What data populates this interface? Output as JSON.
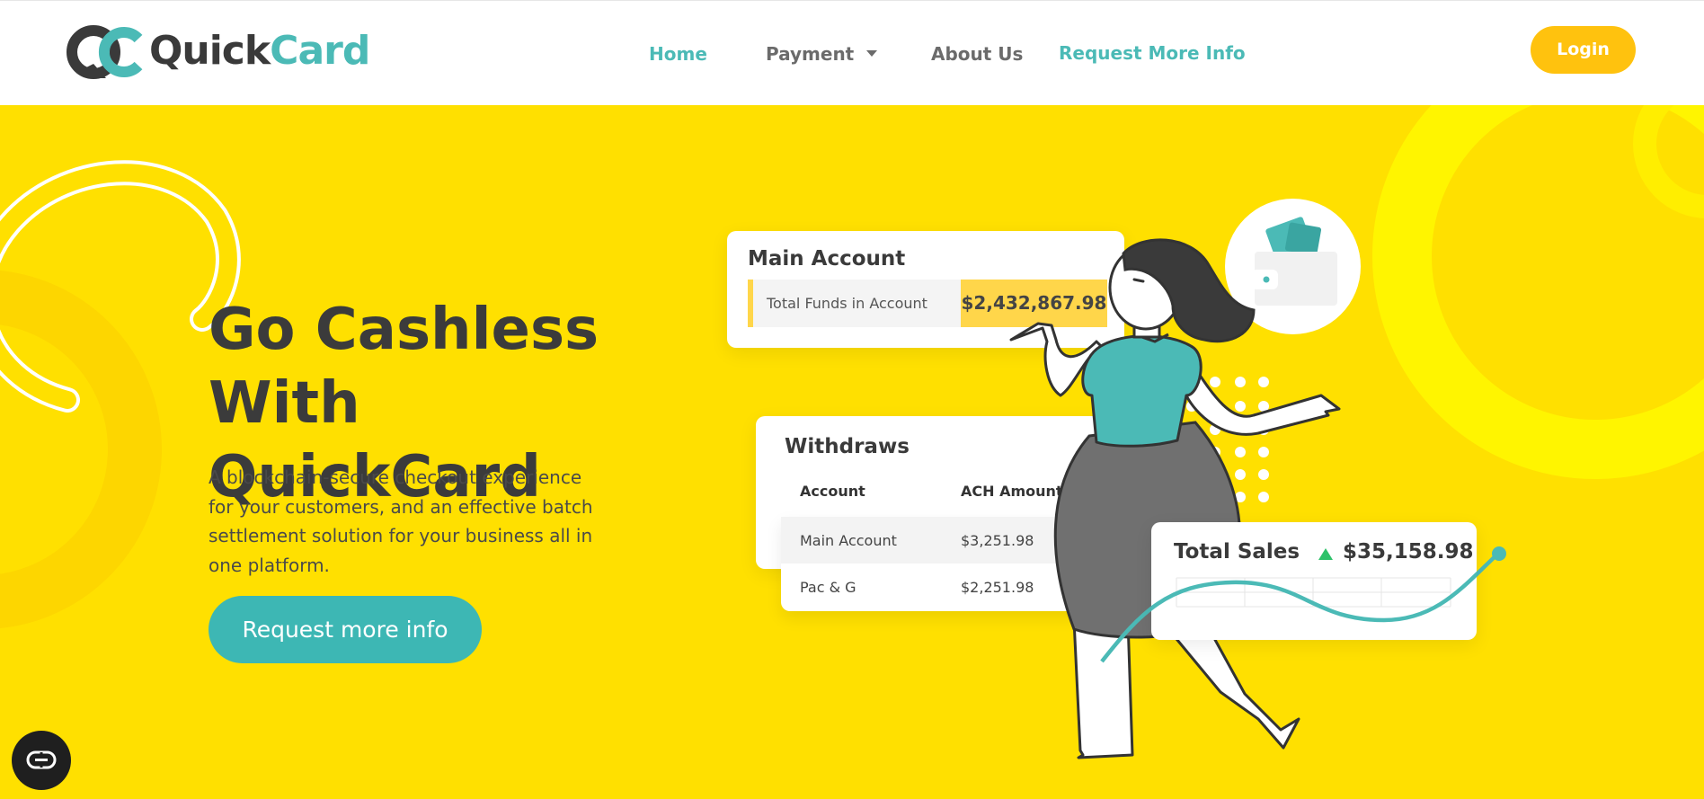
{
  "header": {
    "logo": {
      "text_dark": "Quick",
      "text_accent": "Card"
    },
    "nav": {
      "home": "Home",
      "payment": "Payment",
      "about": "About Us",
      "request": "Request More Info"
    },
    "login_label": "Login"
  },
  "hero": {
    "title_line1": "Go Cashless",
    "title_line2": "With QuickCard",
    "description": "A blockchain-secure checkout experience for your customers, and an effective batch settlement solution for your business all in one platform.",
    "cta_label": "Request more info"
  },
  "cards": {
    "main_account": {
      "title": "Main Account",
      "funds_label": "Total Funds in Account",
      "funds_value": "$2,432,867.98"
    },
    "withdraws": {
      "title": "Withdraws",
      "columns": [
        "Account",
        "ACH Amount"
      ],
      "rows": [
        [
          "Main Account",
          "$3,251.98"
        ],
        [
          "Pac & G",
          "$2,251.98"
        ]
      ]
    },
    "total_sales": {
      "title": "Total Sales",
      "value": "$35,158.98",
      "trend": "up"
    }
  },
  "colors": {
    "background": "#FFE000",
    "teal": "#4BBAB6",
    "login": "#FFC20E",
    "funds_highlight": "#FFD64A",
    "trend_up": "#2EC26A",
    "dark_text": "#3B3B3B"
  },
  "icons": [
    "quickcard-logo-icon",
    "chevron-down-icon",
    "wallet-icon",
    "chat-icon"
  ]
}
